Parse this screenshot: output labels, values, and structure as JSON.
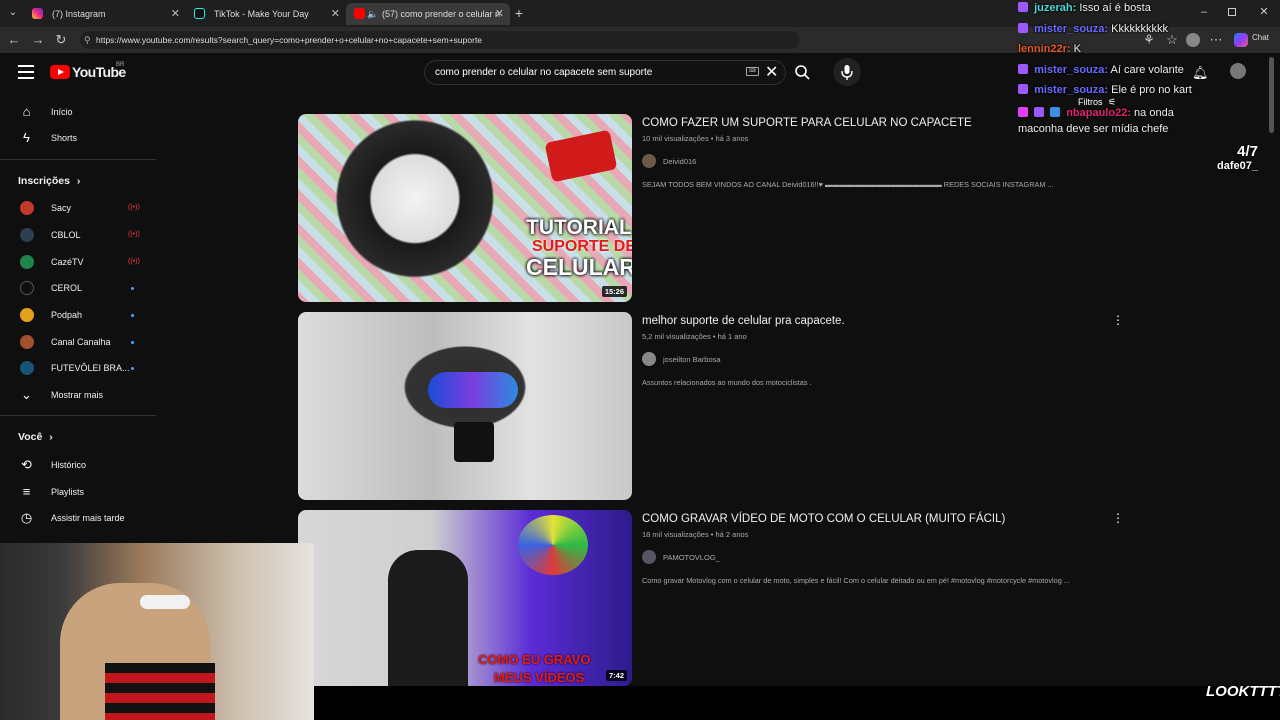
{
  "browser": {
    "tabs": [
      {
        "title": "(7) Instagram",
        "active": false
      },
      {
        "title": "TikTok - Make Your Day",
        "active": false
      },
      {
        "title": "(57) como prender o celular n",
        "active": true
      }
    ],
    "url": "https://www.youtube.com/results?search_query=como+prender+o+celular+no+capacete+sem+suporte"
  },
  "youtube": {
    "logo_text": "YouTube",
    "country_code": "BR",
    "search_query": "como prender o celular no capacete sem suporte",
    "filters_label": "Filtros",
    "sidebar": {
      "main": [
        {
          "label": "Início",
          "icon": "home-icon"
        },
        {
          "label": "Shorts",
          "icon": "shorts-icon"
        }
      ],
      "subscriptions_heading": "Inscrições",
      "subscriptions": [
        {
          "label": "Sacy",
          "status": "live",
          "color": "#c0392b"
        },
        {
          "label": "CBLOL",
          "status": "live",
          "color": "#2c3e50"
        },
        {
          "label": "CazéTV",
          "status": "live",
          "color": "#1e8449"
        },
        {
          "label": "CEROL",
          "status": "new",
          "color": "#0f0f0f"
        },
        {
          "label": "Podpah",
          "status": "new",
          "color": "#e4a11b"
        },
        {
          "label": "Canal Canalha",
          "status": "new",
          "color": "#a0522d"
        },
        {
          "label": "FUTEVÔLEI BRA...",
          "status": "new",
          "color": "#1a5276"
        }
      ],
      "show_more": "Mostrar mais",
      "you_heading": "Você",
      "you": [
        {
          "label": "Histórico",
          "icon": "history-icon"
        },
        {
          "label": "Playlists",
          "icon": "playlists-icon"
        },
        {
          "label": "Assistir mais tarde",
          "icon": "watch-later-icon"
        }
      ]
    },
    "results": [
      {
        "title": "COMO FAZER UM SUPORTE PARA CELULAR NO CAPACETE",
        "meta": "10 mil visualizações • há 3 anos",
        "channel": "Deivid016",
        "description": "SEJAM TODOS BEM VINDOS AO CANAL Deivid016!!♥ ▬▬▬▬▬▬▬▬▬▬▬▬▬▬▬▬ REDES SOCIAIS INSTAGRAM ...",
        "duration": "15:26",
        "thumb_text": [
          "TUTORIAL",
          "SUPORTE DE",
          "CELULAR"
        ]
      },
      {
        "title": "melhor suporte de celular pra capacete.",
        "meta": "5,2 mil visualizações • há 1 ano",
        "channel": "joseilton Barbosa",
        "description": "Assuntos relacionados ao mundo dos motociclistas .",
        "duration": "",
        "thumb_text": []
      },
      {
        "title": "COMO GRAVAR VÍDEO DE MOTO COM O CELULAR (MUITO FÁCIL)",
        "meta": "18 mil visualizações • há 2 anos",
        "channel": "PAMOTOVLOG_",
        "description": "Como gravar Motovlog com o celular de moto, simples e fácil! Com o celular deitado ou em pé! #motovlog #motorcycle #motovlog ...",
        "duration": "7:42",
        "thumb_text": [
          "COMO EU GRAVO",
          "MEUS VÍDEOS"
        ]
      }
    ]
  },
  "stream_overlay": {
    "chat": [
      {
        "user": "juzerah:",
        "message": "Isso aí é bosta",
        "color": "#4ad9d9"
      },
      {
        "user": "mister_souza:",
        "message": "Kkkkkkkkkk",
        "color": "#6a6aff"
      },
      {
        "user": "lennin22r:",
        "message": "K",
        "color": "#e05a2a"
      },
      {
        "user": "mister_souza:",
        "message": "Aí care volante",
        "color": "#6a6aff"
      },
      {
        "user": "mister_souza:",
        "message": "Ele é pro no kart",
        "color": "#6a6aff"
      },
      {
        "user": "nbapaulo22:",
        "message": "na onda maconha deve ser mídia chefe",
        "color": "#e0246e"
      }
    ],
    "counter": "4/7",
    "counter_user": "dafe07_",
    "watermark": "LOOKTTTT"
  }
}
